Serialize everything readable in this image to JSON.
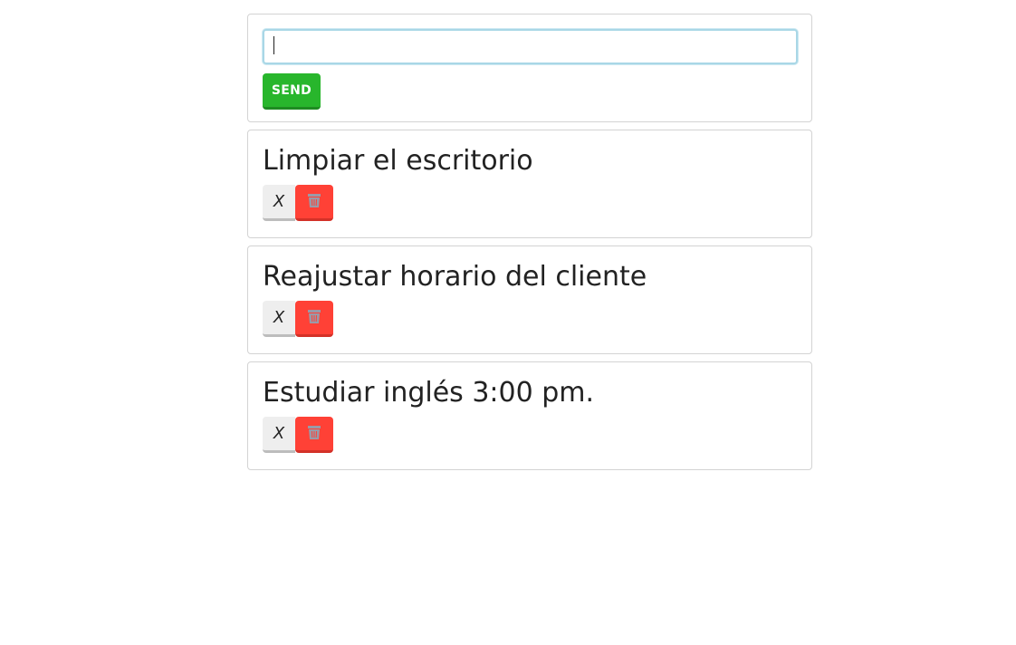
{
  "form": {
    "input_value": "",
    "send_label": "Send"
  },
  "tasks": [
    {
      "title": "Limpiar el escritorio",
      "complete_label": "X",
      "delete_icon": "trash-icon"
    },
    {
      "title": "Reajustar horario del cliente",
      "complete_label": "X",
      "delete_icon": "trash-icon"
    },
    {
      "title": "Estudiar inglés 3:00 pm.",
      "complete_label": "X",
      "delete_icon": "trash-icon"
    }
  ],
  "colors": {
    "send": "#28b62c",
    "delete": "#ff4136",
    "complete": "#eeeeee",
    "input_focus": "#a9d7e6"
  }
}
